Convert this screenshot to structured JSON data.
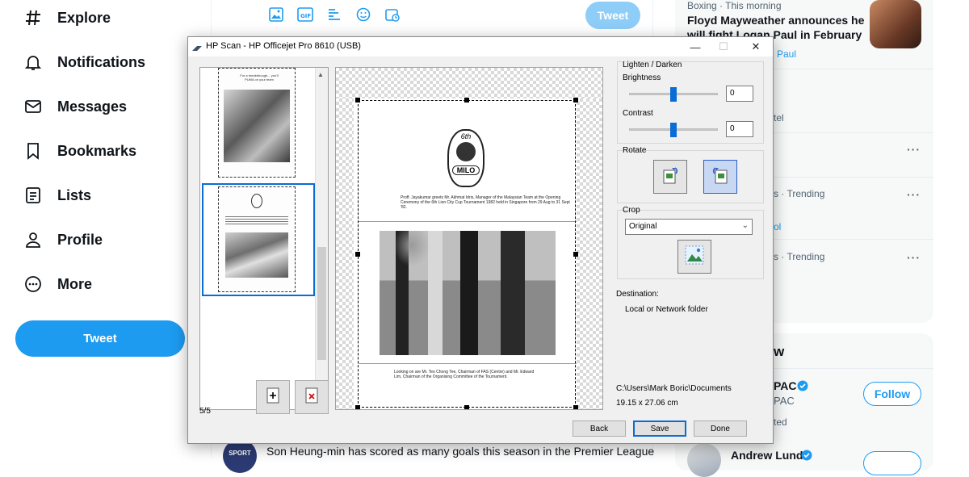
{
  "nav": {
    "items": [
      {
        "label": "Explore",
        "icon": "hashtag-icon"
      },
      {
        "label": "Notifications",
        "icon": "bell-icon"
      },
      {
        "label": "Messages",
        "icon": "envelope-icon"
      },
      {
        "label": "Bookmarks",
        "icon": "bookmark-icon"
      },
      {
        "label": "Lists",
        "icon": "list-icon"
      },
      {
        "label": "Profile",
        "icon": "person-icon"
      },
      {
        "label": "More",
        "icon": "more-circle-icon"
      }
    ],
    "tweet_label": "Tweet"
  },
  "composer": {
    "tweet_label": "Tweet",
    "icons": [
      "image-icon",
      "gif-icon",
      "poll-icon",
      "emoji-icon",
      "schedule-icon"
    ]
  },
  "bottom_tweet": {
    "avatar_text": "SPORT",
    "text": "Son Heung-min has scored as many goals this season in the Premier League"
  },
  "trends": {
    "top_category": "Boxing · This morning",
    "top_headline_1": "Floyd Mayweather announces he",
    "top_headline_2": "will fight Logan Paul in February",
    "top_tail": "Paul",
    "fragment_1": "tel",
    "trending_1": "s · Trending",
    "fragment_2": "ol",
    "trending_2": "s · Trending",
    "more": "···"
  },
  "who_to_follow": {
    "heading_fragment": "w",
    "acct1_name": "PAC",
    "acct1_handle": "PAC",
    "acct1_sub": "ted",
    "follow_label": "Follow",
    "acct2_name": "Andrew Lund"
  },
  "dialog": {
    "title": "HP Scan - HP Officejet Pro 8610 (USB)",
    "page_counter": "5/5",
    "lighten_darken_label": "Lighten / Darken",
    "brightness_label": "Brightness",
    "brightness_value": "0",
    "contrast_label": "Contrast",
    "contrast_value": "0",
    "rotate_label": "Rotate",
    "crop_label": "Crop",
    "crop_option": "Original",
    "destination_label": "Destination:",
    "destination_value": "Local or Network folder",
    "path": "C:\\Users\\Mark Boric\\Documents",
    "size": "19.15 x 27.06 cm",
    "back_label": "Back",
    "save_label": "Save",
    "done_label": "Done",
    "doc_caption_1": "Proff. Jayakumar greets Mr. Akhmat Idris, Manager of the Malaysian Team at the Opening Ceremony of the 6th Lion City Cup Tournament 1982 held in Singapore from 29 Aug to 31 Sept '82.",
    "doc_caption_2": "Looking on are Mr. Teo Chong Tee, Chairman of FAS (Centre) and Mr. Edward Lim, Chairman of the Organising Committee of the Tournament.",
    "logo_text": "MILO",
    "logo_top": "6th",
    "thumb1_text": "For a breakthrough... you'll PUMA on your team"
  }
}
